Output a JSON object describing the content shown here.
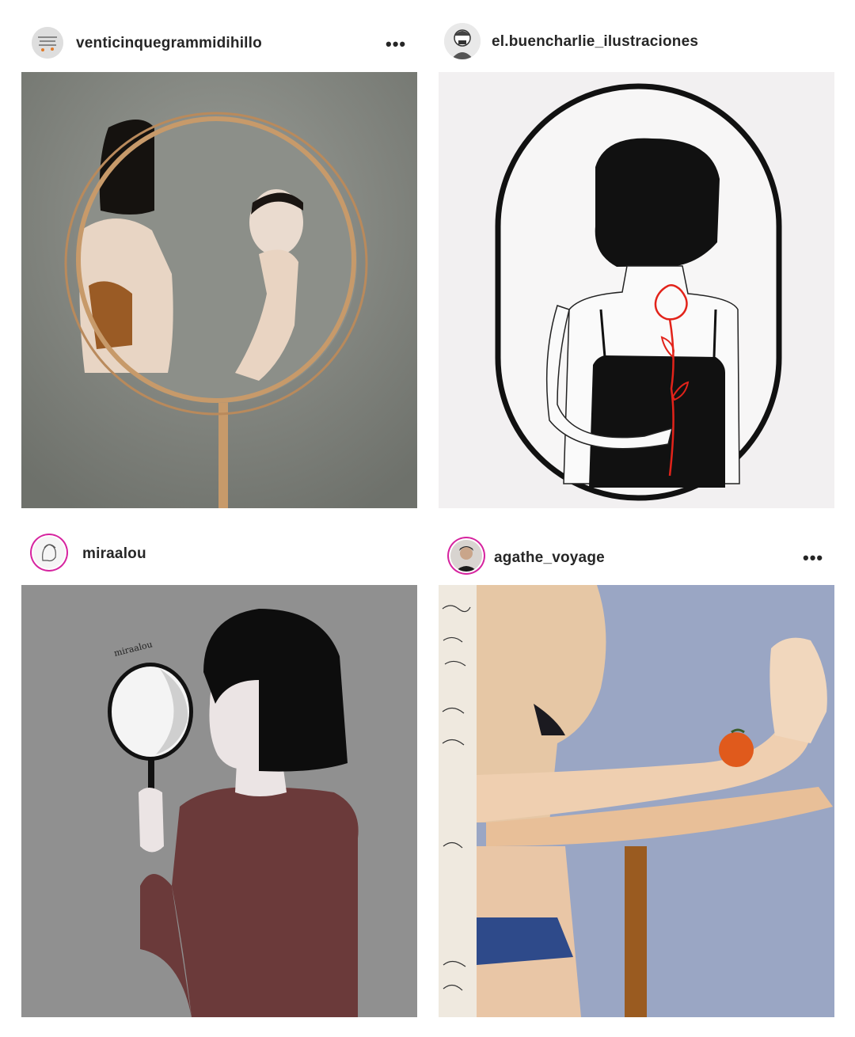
{
  "posts": [
    {
      "username": "venticinquegrammidihillo",
      "avatar_icon": "text-avatar-icon",
      "more_label": "•••",
      "has_more": true,
      "artwork": "painting-woman-round-mirror"
    },
    {
      "username": "el.buencharlie_ilustraciones",
      "avatar_icon": "sketched-portrait-avatar-icon",
      "more_label": "",
      "has_more": false,
      "artwork": "ink-drawing-woman-rose-tattoo"
    },
    {
      "username": "miraalou",
      "avatar_icon": "line-drawing-avatar-icon",
      "more_label": "",
      "has_more": false,
      "artwork": "flat-illustration-woman-hand-mirror",
      "art_signature": "miraalou"
    },
    {
      "username": "agathe_voyage",
      "avatar_icon": "photo-avatar-icon",
      "more_label": "•••",
      "has_more": true,
      "artwork": "painting-arms-orange"
    }
  ],
  "colors": {
    "story_ring": "#d6249f",
    "gray_wall": "#8f928c",
    "ink": "#111111",
    "rose_red": "#e2231a",
    "maroon_sweater": "#6b3a3a",
    "orange": "#e05a1c"
  }
}
